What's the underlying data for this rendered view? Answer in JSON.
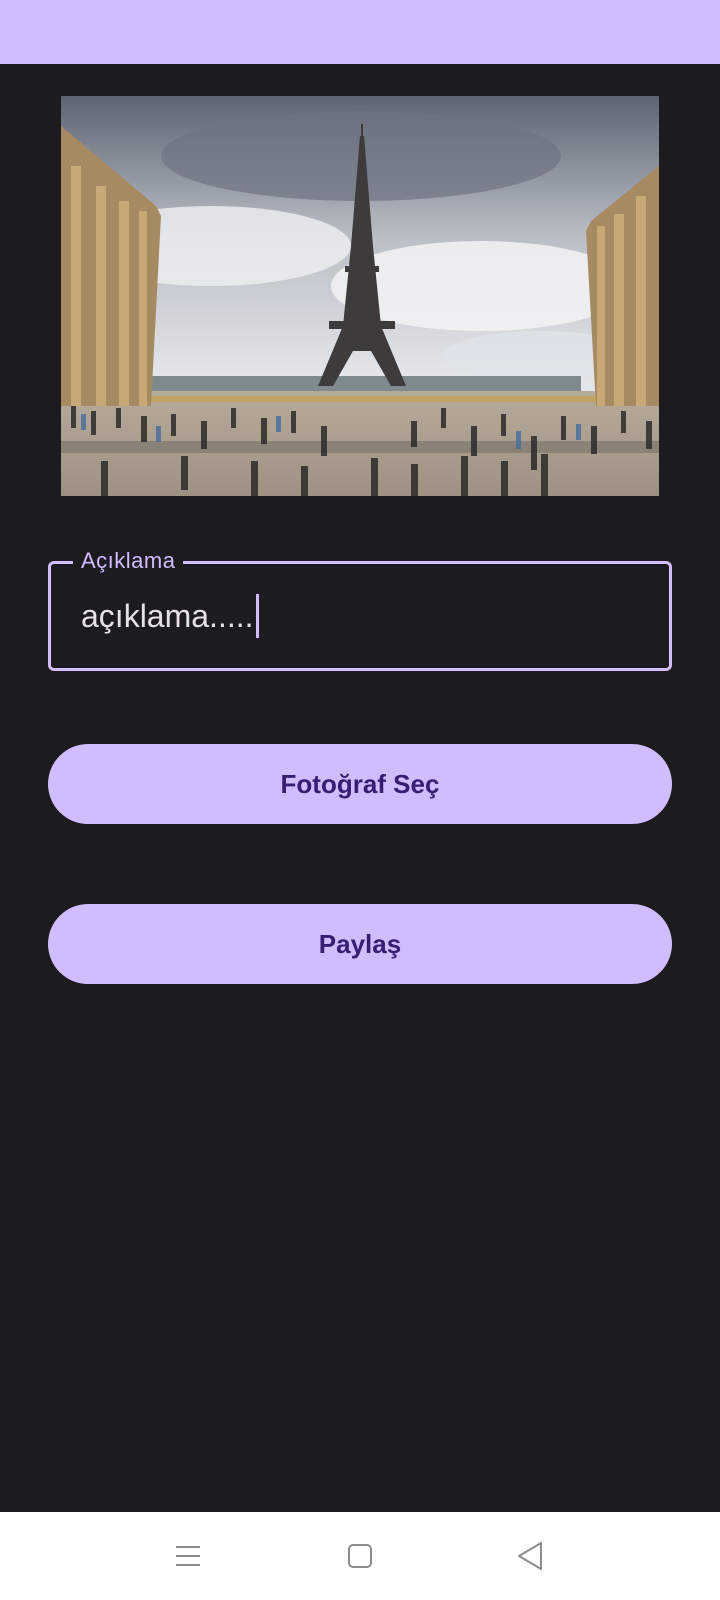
{
  "description_field": {
    "label": "Açıklama",
    "value": "açıklama....."
  },
  "buttons": {
    "select_photo_label": "Fotoğraf Seç",
    "share_label": "Paylaş"
  },
  "photo": {
    "subject": "eiffel-tower-trocadero-photo"
  },
  "navigation": {
    "menu_icon": "menu-icon",
    "home_icon": "home-icon",
    "back_icon": "back-icon"
  },
  "colors": {
    "accent": "#d0bcff",
    "on_accent": "#381e72",
    "background": "#1c1b20",
    "text": "#e6e1e5"
  }
}
